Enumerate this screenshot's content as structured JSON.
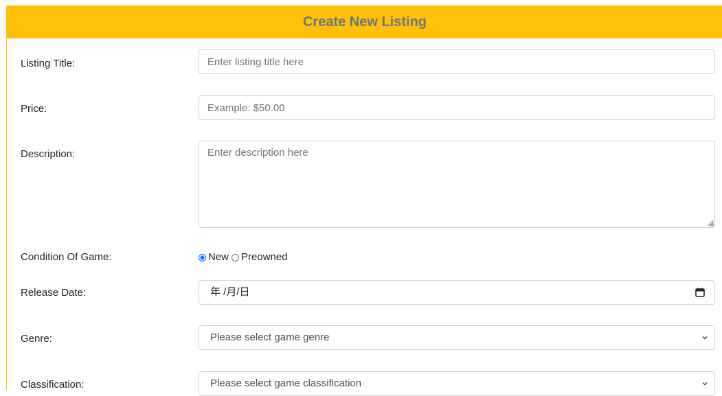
{
  "header": {
    "title": "Create New Listing"
  },
  "form": {
    "listing_title": {
      "label": "Listing Title:",
      "placeholder": "Enter listing title here",
      "value": ""
    },
    "price": {
      "label": "Price:",
      "placeholder": "Example: $50.00",
      "value": ""
    },
    "description": {
      "label": "Description:",
      "placeholder": "Enter description here",
      "value": ""
    },
    "condition": {
      "label": "Condition Of Game:",
      "options": [
        {
          "label": "New",
          "checked": true
        },
        {
          "label": "Preowned",
          "checked": false
        }
      ]
    },
    "release_date": {
      "label": "Release Date:",
      "display": "年 /月/日",
      "icon": "calendar-icon"
    },
    "genre": {
      "label": "Genre:",
      "selected": "Please select game genre",
      "icon": "chevron-down-icon"
    },
    "classification": {
      "label": "Classification:",
      "selected": "Please select game classification",
      "icon": "chevron-down-icon"
    }
  },
  "colors": {
    "header_bg": "#ffc107",
    "header_text": "#6c757d",
    "radio_accent": "#0d6efd",
    "input_border": "#ced4da"
  }
}
